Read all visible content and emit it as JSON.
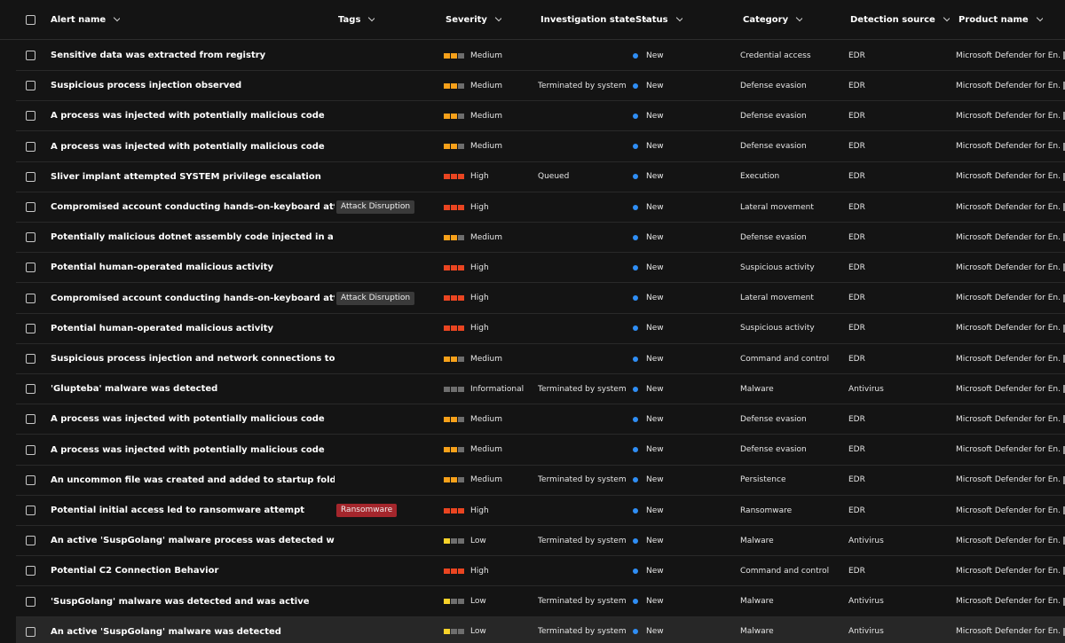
{
  "headers": {
    "alert_name": "Alert name",
    "tags": "Tags",
    "severity": "Severity",
    "investigation_state": "Investigation state",
    "status": "Status",
    "category": "Category",
    "detection_source": "Detection source",
    "product_name": "Product name"
  },
  "severity_colors": {
    "Medium": [
      "#f7a11a",
      "#f7a11a",
      "#6e6e6e"
    ],
    "High": [
      "#ea4521",
      "#ea4521",
      "#ea4521"
    ],
    "Low": [
      "#f8d22a",
      "#6e6e6e",
      "#6e6e6e"
    ],
    "Informational": [
      "#6e6e6e",
      "#6e6e6e",
      "#6e6e6e"
    ]
  },
  "tag_colors": {
    "Attack Disruption": "#3a3a3a",
    "Ransomware": "#a4262c"
  },
  "status_color": "#2f8ef5",
  "rows": [
    {
      "name": "Sensitive data was extracted from registry",
      "tag": "",
      "severity": "Medium",
      "investigation": "",
      "status": "New",
      "category": "Credential access",
      "source": "EDR",
      "product": "Microsoft Defender for En..."
    },
    {
      "name": "Suspicious process injection observed",
      "tag": "",
      "severity": "Medium",
      "investigation": "Terminated by system",
      "status": "New",
      "category": "Defense evasion",
      "source": "EDR",
      "product": "Microsoft Defender for En..."
    },
    {
      "name": "A process was injected with potentially malicious code",
      "tag": "",
      "severity": "Medium",
      "investigation": "",
      "status": "New",
      "category": "Defense evasion",
      "source": "EDR",
      "product": "Microsoft Defender for En..."
    },
    {
      "name": "A process was injected with potentially malicious code",
      "tag": "",
      "severity": "Medium",
      "investigation": "",
      "status": "New",
      "category": "Defense evasion",
      "source": "EDR",
      "product": "Microsoft Defender for En..."
    },
    {
      "name": "Sliver implant attempted SYSTEM privilege escalation",
      "tag": "",
      "severity": "High",
      "investigation": "Queued",
      "status": "New",
      "category": "Execution",
      "source": "EDR",
      "product": "Microsoft Defender for En..."
    },
    {
      "name": "Compromised account conducting hands-on-keyboard attack",
      "tag": "Attack Disruption",
      "severity": "High",
      "investigation": "",
      "status": "New",
      "category": "Lateral movement",
      "source": "EDR",
      "product": "Microsoft Defender for En..."
    },
    {
      "name": "Potentially malicious dotnet assembly code injected in a process",
      "tag": "",
      "severity": "Medium",
      "investigation": "",
      "status": "New",
      "category": "Defense evasion",
      "source": "EDR",
      "product": "Microsoft Defender for En..."
    },
    {
      "name": "Potential human-operated malicious activity",
      "tag": "",
      "severity": "High",
      "investigation": "",
      "status": "New",
      "category": "Suspicious activity",
      "source": "EDR",
      "product": "Microsoft Defender for En..."
    },
    {
      "name": "Compromised account conducting hands-on-keyboard attack",
      "tag": "Attack Disruption",
      "severity": "High",
      "investigation": "",
      "status": "New",
      "category": "Lateral movement",
      "source": "EDR",
      "product": "Microsoft Defender for En..."
    },
    {
      "name": "Potential human-operated malicious activity",
      "tag": "",
      "severity": "High",
      "investigation": "",
      "status": "New",
      "category": "Suspicious activity",
      "source": "EDR",
      "product": "Microsoft Defender for En..."
    },
    {
      "name": "Suspicious process injection and network connections to an unc...",
      "tag": "",
      "severity": "Medium",
      "investigation": "",
      "status": "New",
      "category": "Command and control",
      "source": "EDR",
      "product": "Microsoft Defender for En..."
    },
    {
      "name": "'Glupteba' malware was detected",
      "tag": "",
      "severity": "Informational",
      "investigation": "Terminated by system",
      "status": "New",
      "category": "Malware",
      "source": "Antivirus",
      "product": "Microsoft Defender for En..."
    },
    {
      "name": "A process was injected with potentially malicious code",
      "tag": "",
      "severity": "Medium",
      "investigation": "",
      "status": "New",
      "category": "Defense evasion",
      "source": "EDR",
      "product": "Microsoft Defender for En..."
    },
    {
      "name": "A process was injected with potentially malicious code",
      "tag": "",
      "severity": "Medium",
      "investigation": "",
      "status": "New",
      "category": "Defense evasion",
      "source": "EDR",
      "product": "Microsoft Defender for En..."
    },
    {
      "name": "An uncommon file was created and added to startup folder",
      "tag": "",
      "severity": "Medium",
      "investigation": "Terminated by system",
      "status": "New",
      "category": "Persistence",
      "source": "EDR",
      "product": "Microsoft Defender for En..."
    },
    {
      "name": "Potential initial access led to ransomware attempt",
      "tag": "Ransomware",
      "severity": "High",
      "investigation": "",
      "status": "New",
      "category": "Ransomware",
      "source": "EDR",
      "product": "Microsoft Defender for En..."
    },
    {
      "name": "An active 'SuspGolang' malware process was detected while exe...",
      "tag": "",
      "severity": "Low",
      "investigation": "Terminated by system",
      "status": "New",
      "category": "Malware",
      "source": "Antivirus",
      "product": "Microsoft Defender for En..."
    },
    {
      "name": "Potential C2 Connection Behavior",
      "tag": "",
      "severity": "High",
      "investigation": "",
      "status": "New",
      "category": "Command and control",
      "source": "EDR",
      "product": "Microsoft Defender for En..."
    },
    {
      "name": "'SuspGolang' malware was detected and was active",
      "tag": "",
      "severity": "Low",
      "investigation": "Terminated by system",
      "status": "New",
      "category": "Malware",
      "source": "Antivirus",
      "product": "Microsoft Defender for En..."
    },
    {
      "name": "An active 'SuspGolang' malware was detected",
      "tag": "",
      "severity": "Low",
      "investigation": "Terminated by system",
      "status": "New",
      "category": "Malware",
      "source": "Antivirus",
      "product": "Microsoft Defender for En...",
      "highlighted": true
    }
  ]
}
